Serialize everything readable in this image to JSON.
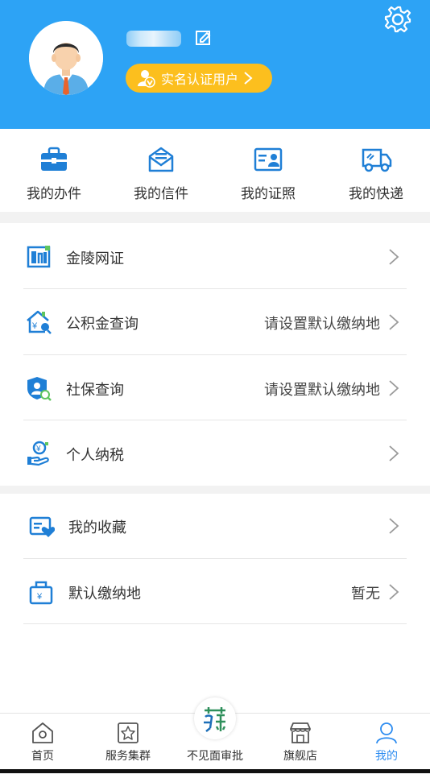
{
  "profile": {
    "verified_badge_label": "实名认证用户"
  },
  "quick_actions": [
    {
      "label": "我的办件",
      "icon": "briefcase-icon"
    },
    {
      "label": "我的信件",
      "icon": "envelope-icon"
    },
    {
      "label": "我的证照",
      "icon": "id-card-icon"
    },
    {
      "label": "我的快递",
      "icon": "delivery-truck-icon"
    }
  ],
  "menu_group_1": [
    {
      "label": "金陵网证",
      "value": "",
      "icon": "network-id-icon"
    },
    {
      "label": "公积金查询",
      "value": "请设置默认缴纳地",
      "icon": "housing-fund-icon"
    },
    {
      "label": "社保查询",
      "value": "请设置默认缴纳地",
      "icon": "social-security-icon"
    },
    {
      "label": "个人纳税",
      "value": "",
      "icon": "tax-hand-icon"
    }
  ],
  "menu_group_2": [
    {
      "label": "我的收藏",
      "value": "",
      "icon": "favorites-icon"
    },
    {
      "label": "默认缴纳地",
      "value": "暂无",
      "icon": "payment-location-icon"
    }
  ],
  "tabbar": {
    "items": [
      {
        "label": "首页",
        "icon": "home-icon",
        "active": false
      },
      {
        "label": "服务集群",
        "icon": "service-cluster-icon",
        "active": false
      },
      {
        "label": "不见面审批",
        "icon": "su-logo-icon",
        "active": false
      },
      {
        "label": "旗舰店",
        "icon": "store-icon",
        "active": false
      },
      {
        "label": "我的",
        "icon": "user-icon",
        "active": true
      }
    ]
  },
  "colors": {
    "header_bg": "#2da3f5",
    "badge_bg": "#fcbf1e",
    "icon_blue": "#1f7fd6",
    "tab_active": "#2d8cf0"
  }
}
